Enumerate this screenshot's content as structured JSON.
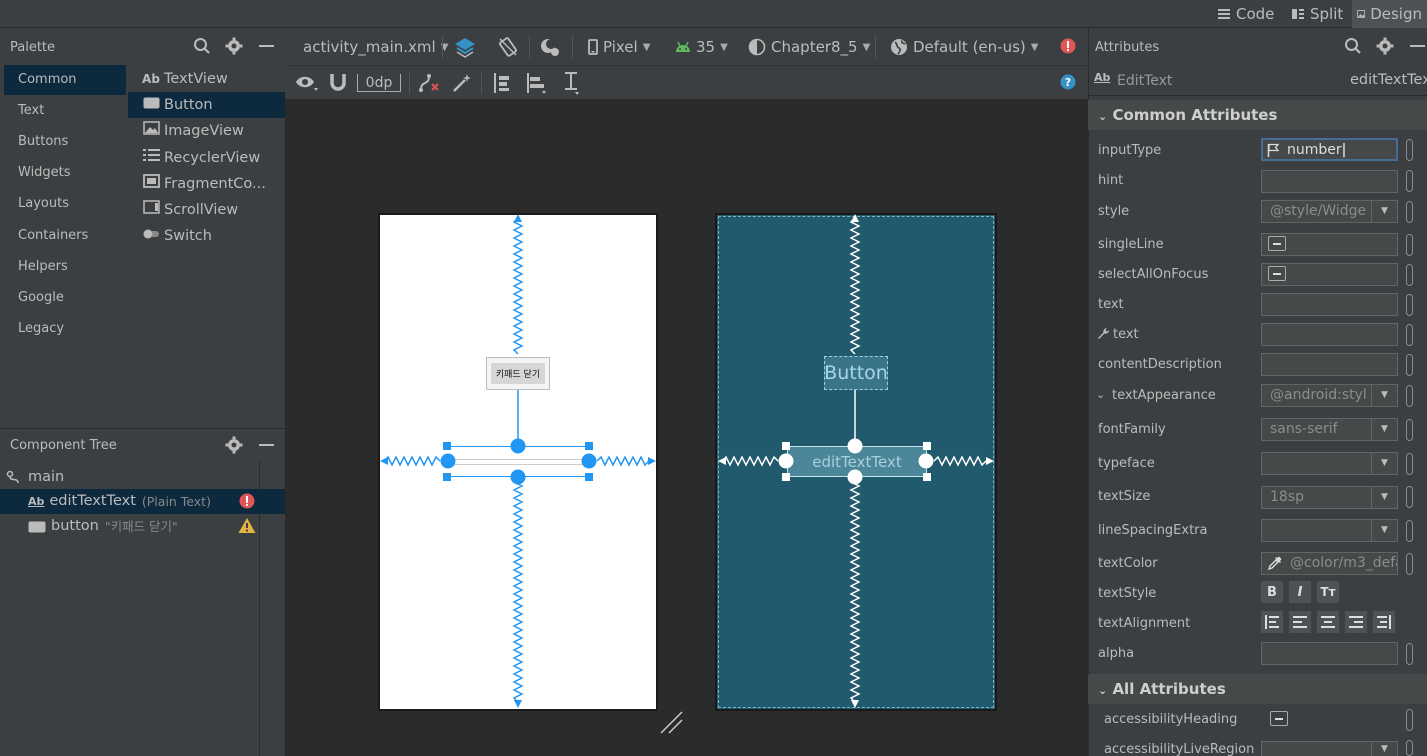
{
  "view_modes": [
    {
      "label": "Code",
      "icon": "lines-icon"
    },
    {
      "label": "Split",
      "icon": "split-icon"
    },
    {
      "label": "Design",
      "icon": "image-icon"
    }
  ],
  "palette": {
    "title": "Palette",
    "categories": [
      "Common",
      "Text",
      "Buttons",
      "Widgets",
      "Layouts",
      "Containers",
      "Helpers",
      "Google",
      "Legacy"
    ],
    "components": [
      {
        "label": "TextView",
        "icon": "Ab"
      },
      {
        "label": "Button",
        "icon": "button-icon"
      },
      {
        "label": "ImageView",
        "icon": "image-icon"
      },
      {
        "label": "RecyclerView",
        "icon": "list-icon"
      },
      {
        "label": "FragmentCo...",
        "icon": "fragment-icon"
      },
      {
        "label": "ScrollView",
        "icon": "scroll-icon"
      },
      {
        "label": "Switch",
        "icon": "switch-icon"
      }
    ]
  },
  "component_tree": {
    "title": "Component Tree",
    "root": "main",
    "items": [
      {
        "label": "editTextText",
        "hint": "(Plain Text)",
        "status": "error"
      },
      {
        "label": "button",
        "hint": "\"키패드 닫기\"",
        "status": "warning"
      }
    ]
  },
  "toolbar": {
    "file": "activity_main.xml",
    "device": "Pixel",
    "api": "35",
    "theme": "Chapter8_5",
    "locale": "Default (en-us)",
    "margin": "0dp"
  },
  "canvas": {
    "button_text_design": "키패드 닫기",
    "button_text_blueprint": "Button",
    "edit_text_blueprint": "editTextText"
  },
  "attributes": {
    "title": "Attributes",
    "widget_type": "EditText",
    "widget_id": "editTextTex",
    "common_section": "Common Attributes",
    "all_section": "All Attributes",
    "input_type_value": "number",
    "style_value": "@style/Widge",
    "text_appearance_value": "@android:styl",
    "font_family_value": "sans-serif",
    "text_size_value": "18sp",
    "text_color_value": "@color/m3_defa",
    "labels": {
      "inputType": "inputType",
      "hint": "hint",
      "style": "style",
      "singleLine": "singleLine",
      "selectAllOnFocus": "selectAllOnFocus",
      "text": "text",
      "text_tools": "text",
      "contentDescription": "contentDescription",
      "textAppearance": "textAppearance",
      "fontFamily": "fontFamily",
      "typeface": "typeface",
      "textSize": "textSize",
      "lineSpacingExtra": "lineSpacingExtra",
      "textColor": "textColor",
      "textStyle": "textStyle",
      "textAlignment": "textAlignment",
      "alpha": "alpha",
      "accessibilityHeading": "accessibilityHeading",
      "accessibilityLiveRegion": "accessibilityLiveRegion"
    },
    "text_style_buttons": [
      "B",
      "I",
      "Tт"
    ]
  },
  "colors": {
    "accent_blue": "#2196f3",
    "error_red": "#e05555",
    "warning_yellow": "#e3b341",
    "blueprint_bg": "#205a6c"
  }
}
